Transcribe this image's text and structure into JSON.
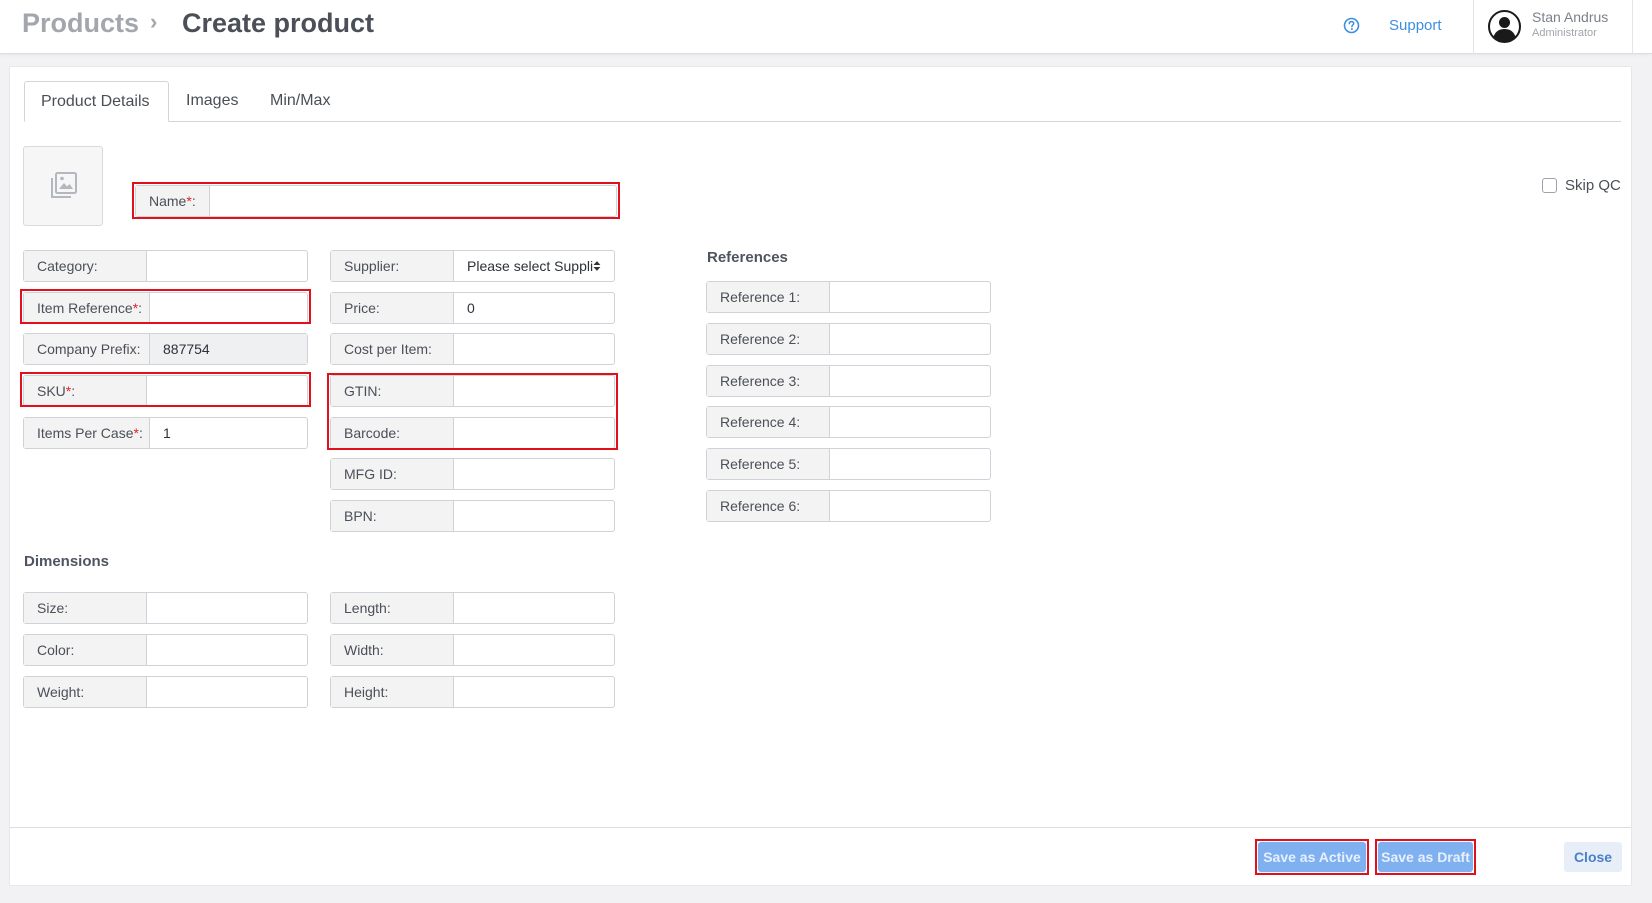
{
  "header": {
    "breadcrumb_root": "Products",
    "breadcrumb_separator": "›",
    "breadcrumb_current": "Create product",
    "support_label": "Support",
    "help_icon": "question-circle-icon",
    "user": {
      "name": "Stan Andrus",
      "role": "Administrator",
      "avatar_icon": "user-avatar-icon"
    }
  },
  "tabs": [
    {
      "label": "Product Details",
      "active": true
    },
    {
      "label": "Images",
      "active": false
    },
    {
      "label": "Min/Max",
      "active": false
    }
  ],
  "image_placeholder_icon": "image-gallery-icon",
  "skip_qc": {
    "label": "Skip QC",
    "checked": false
  },
  "required_marker": "*",
  "name_field": {
    "label": "Name",
    "value": ""
  },
  "left_fields": {
    "category": {
      "label": "Category:",
      "value": ""
    },
    "item_reference": {
      "label": "Item Reference",
      "value": ""
    },
    "company_prefix": {
      "label": "Company Prefix:",
      "value": "887754"
    },
    "sku": {
      "label": "SKU",
      "value": ""
    },
    "items_per_case": {
      "label": "Items Per Case",
      "value": "1"
    }
  },
  "middle_fields": {
    "supplier": {
      "label": "Supplier:",
      "value": "Please select Supplier",
      "icon": "sort-caret-icon"
    },
    "price": {
      "label": "Price:",
      "value": "0"
    },
    "cost_per_item": {
      "label": "Cost per Item:",
      "value": ""
    },
    "gtin": {
      "label": "GTIN:",
      "value": ""
    },
    "barcode": {
      "label": "Barcode:",
      "value": ""
    },
    "mfg_id": {
      "label": "MFG ID:",
      "value": ""
    },
    "bpn": {
      "label": "BPN:",
      "value": ""
    }
  },
  "references": {
    "title": "References",
    "items": [
      {
        "label": "Reference 1:",
        "value": ""
      },
      {
        "label": "Reference 2:",
        "value": ""
      },
      {
        "label": "Reference 3:",
        "value": ""
      },
      {
        "label": "Reference 4:",
        "value": ""
      },
      {
        "label": "Reference 5:",
        "value": ""
      },
      {
        "label": "Reference 6:",
        "value": ""
      }
    ]
  },
  "dimensions": {
    "title": "Dimensions",
    "size": {
      "label": "Size:",
      "value": ""
    },
    "color": {
      "label": "Color:",
      "value": ""
    },
    "weight": {
      "label": "Weight:",
      "value": ""
    },
    "length": {
      "label": "Length:",
      "value": ""
    },
    "width": {
      "label": "Width:",
      "value": ""
    },
    "height": {
      "label": "Height:",
      "value": ""
    }
  },
  "footer": {
    "save_active_label": "Save as Active",
    "save_draft_label": "Save as Draft",
    "close_label": "Close"
  },
  "colors": {
    "highlight": "#e0101c",
    "primary_disabled": "#7fb0f0",
    "link": "#3e8ee0",
    "required": "#e02424"
  }
}
